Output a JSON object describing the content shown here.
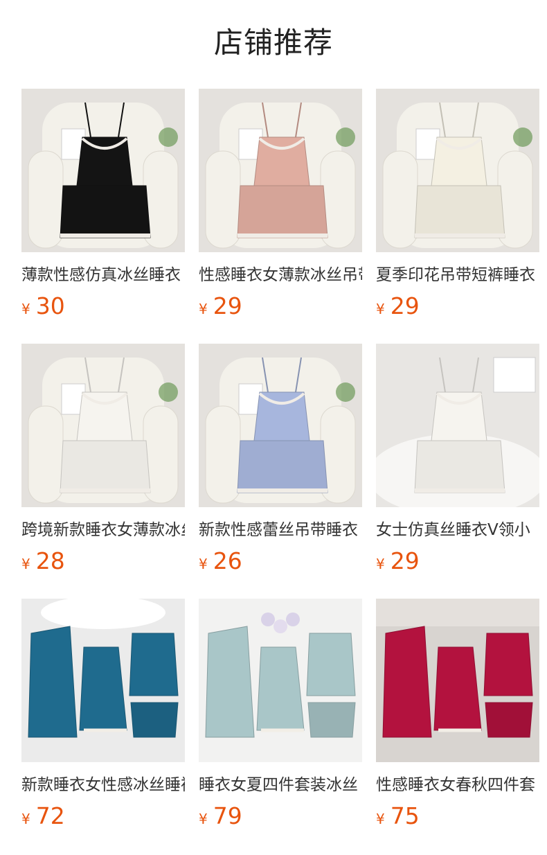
{
  "page": {
    "title": "店铺推荐",
    "currency": "¥",
    "price_color": "#e8540e"
  },
  "products": [
    {
      "name": "薄款性感仿真冰丝睡衣",
      "price": "30",
      "garment_color": "#141414",
      "image_icon": "black-lace-cami-set-photo",
      "scene": "chair"
    },
    {
      "name": "性感睡衣女薄款冰丝吊带",
      "price": "29",
      "garment_color": "#e0ada0",
      "image_icon": "pink-ruffle-cami-set-photo",
      "scene": "chair"
    },
    {
      "name": "夏季印花吊带短裤睡衣",
      "price": "29",
      "garment_color": "#f4f0e2",
      "image_icon": "cream-print-cami-set-photo",
      "scene": "chair"
    },
    {
      "name": "跨境新款睡衣女薄款冰丝",
      "price": "28",
      "garment_color": "#f6f4ef",
      "image_icon": "floral-cami-set-photo",
      "scene": "chair"
    },
    {
      "name": "新款性感蕾丝吊带睡衣",
      "price": "26",
      "garment_color": "#a7b6dd",
      "image_icon": "blue-floral-lace-set-photo",
      "scene": "chair"
    },
    {
      "name": "女士仿真丝睡衣V领小",
      "price": "29",
      "garment_color": "#f6f4ef",
      "image_icon": "polka-lace-set-photo",
      "scene": "fur"
    },
    {
      "name": "新款睡衣女性感冰丝睡袍",
      "price": "72",
      "garment_color": "#1f6b8e",
      "image_icon": "teal-four-piece-set-photo",
      "scene": "wall"
    },
    {
      "name": "睡衣女夏四件套装冰丝",
      "price": "79",
      "garment_color": "#a9c6c8",
      "image_icon": "sage-four-piece-set-photo",
      "scene": "light"
    },
    {
      "name": "性感睡衣女春秋四件套",
      "price": "75",
      "garment_color": "#b3123e",
      "image_icon": "red-four-piece-set-photo",
      "scene": "floor"
    }
  ]
}
